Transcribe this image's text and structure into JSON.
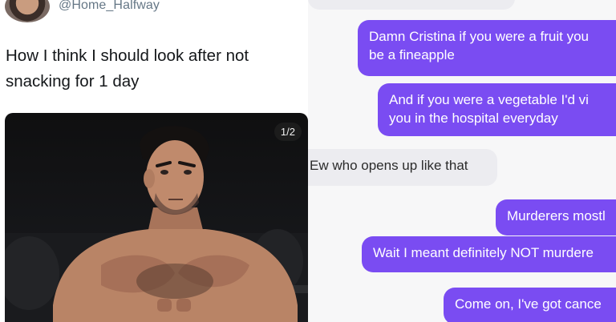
{
  "tweet": {
    "handle": "@Home_Halfway",
    "text_line1": "How I think I should look after not",
    "text_line2": "snacking for 1 day",
    "photo_counter": "1/2"
  },
  "chat": {
    "colors": {
      "outgoing_bubble": "#7a4cf2",
      "incoming_bubble": "#ececf0"
    },
    "messages": [
      {
        "direction": "incoming",
        "lines": [
          ""
        ]
      },
      {
        "direction": "outgoing",
        "lines": [
          "Damn Cristina if you were a fruit you",
          "be a fineapple"
        ]
      },
      {
        "direction": "outgoing",
        "lines": [
          "And if you were a vegetable I'd vi",
          "you in the hospital everyday"
        ]
      },
      {
        "direction": "incoming",
        "lines": [
          "Ew who opens up like that"
        ]
      },
      {
        "direction": "outgoing",
        "lines": [
          "Murderers mostl"
        ]
      },
      {
        "direction": "outgoing",
        "lines": [
          "Wait I meant definitely NOT murdere"
        ]
      },
      {
        "direction": "outgoing",
        "lines": [
          "Come on,  I've got cance"
        ]
      }
    ]
  }
}
